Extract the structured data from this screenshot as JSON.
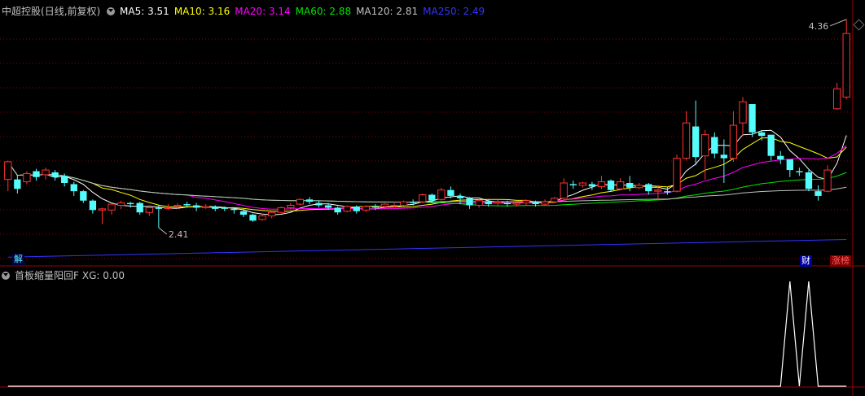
{
  "colors": {
    "bg": "#000000",
    "up": "#ff3232",
    "down": "#54fcfc",
    "ma5": "#ffffff",
    "ma10": "#ffff00",
    "ma20": "#ff00ff",
    "ma60": "#00e600",
    "ma120": "#c0c0c0",
    "ma250": "#3333ff",
    "grid": "#8b0000",
    "axis": "#a00000",
    "xg": "#ffffff"
  },
  "main": {
    "stock_name": "中超控股",
    "period": "(日线,前复权)",
    "ma": [
      {
        "label": "MA5: ",
        "value": "3.51",
        "color": "#ffffff"
      },
      {
        "label": "MA10: ",
        "value": "3.16",
        "color": "#ffff00"
      },
      {
        "label": "MA20: ",
        "value": "3.14",
        "color": "#ff00ff"
      },
      {
        "label": "MA60: ",
        "value": "2.88",
        "color": "#00e600"
      },
      {
        "label": "MA120: ",
        "value": "2.81",
        "color": "#c0c0c0"
      },
      {
        "label": "MA250: ",
        "value": "2.49",
        "color": "#3333ff"
      }
    ],
    "high_label": "4.36",
    "low_label": "2.41",
    "tag_jie": "解",
    "tag_cai": "财",
    "tag_zhangting": "涨榜"
  },
  "sub": {
    "name": "首板缩量阳回F",
    "value_label": "XG: 0.00"
  },
  "chart_data": {
    "type": "candlestick",
    "title": "中超控股 (日线,前复权)",
    "price_range": [
      2.3,
      4.4
    ],
    "candles": [
      [
        3.0,
        3.15,
        3.16,
        2.9
      ],
      [
        3.0,
        2.92,
        3.04,
        2.88
      ],
      [
        2.98,
        3.05,
        3.07,
        2.96
      ],
      [
        3.07,
        3.02,
        3.09,
        2.99
      ],
      [
        3.04,
        3.08,
        3.1,
        3.0
      ],
      [
        3.06,
        3.02,
        3.08,
        2.99
      ],
      [
        3.03,
        2.97,
        3.05,
        2.94
      ],
      [
        2.96,
        2.9,
        2.98,
        2.86
      ],
      [
        2.9,
        2.82,
        2.91,
        2.8
      ],
      [
        2.82,
        2.74,
        2.83,
        2.71
      ],
      [
        2.74,
        2.75,
        2.76,
        2.62
      ],
      [
        2.74,
        2.79,
        2.8,
        2.7
      ],
      [
        2.78,
        2.8,
        2.82,
        2.75
      ],
      [
        2.8,
        2.79,
        2.81,
        2.76
      ],
      [
        2.8,
        2.72,
        2.81,
        2.7
      ],
      [
        2.72,
        2.76,
        2.78,
        2.69
      ],
      [
        2.76,
        2.75,
        2.78,
        2.59
      ],
      [
        2.76,
        2.76,
        2.79,
        2.74
      ],
      [
        2.77,
        2.78,
        2.8,
        2.75
      ],
      [
        2.79,
        2.78,
        2.81,
        2.76
      ],
      [
        2.78,
        2.76,
        2.8,
        2.73
      ],
      [
        2.76,
        2.77,
        2.79,
        2.75
      ],
      [
        2.77,
        2.75,
        2.78,
        2.73
      ],
      [
        2.76,
        2.75,
        2.77,
        2.73
      ],
      [
        2.75,
        2.74,
        2.76,
        2.71
      ],
      [
        2.73,
        2.7,
        2.75,
        2.68
      ],
      [
        2.7,
        2.65,
        2.71,
        2.64
      ],
      [
        2.66,
        2.69,
        2.71,
        2.65
      ],
      [
        2.69,
        2.72,
        2.73,
        2.67
      ],
      [
        2.72,
        2.76,
        2.77,
        2.71
      ],
      [
        2.76,
        2.78,
        2.8,
        2.75
      ],
      [
        2.79,
        2.83,
        2.84,
        2.78
      ],
      [
        2.83,
        2.81,
        2.85,
        2.79
      ],
      [
        2.8,
        2.78,
        2.82,
        2.76
      ],
      [
        2.78,
        2.76,
        2.8,
        2.74
      ],
      [
        2.76,
        2.72,
        2.77,
        2.7
      ],
      [
        2.73,
        2.77,
        2.78,
        2.72
      ],
      [
        2.77,
        2.73,
        2.78,
        2.71
      ],
      [
        2.74,
        2.77,
        2.78,
        2.72
      ],
      [
        2.77,
        2.76,
        2.79,
        2.74
      ],
      [
        2.77,
        2.79,
        2.8,
        2.75
      ],
      [
        2.78,
        2.78,
        2.8,
        2.76
      ],
      [
        2.78,
        2.81,
        2.82,
        2.77
      ],
      [
        2.81,
        2.8,
        2.83,
        2.78
      ],
      [
        2.81,
        2.87,
        2.88,
        2.8
      ],
      [
        2.87,
        2.82,
        2.88,
        2.8
      ],
      [
        2.83,
        2.91,
        2.93,
        2.82
      ],
      [
        2.91,
        2.86,
        2.94,
        2.84
      ],
      [
        2.86,
        2.84,
        2.88,
        2.79
      ],
      [
        2.84,
        2.78,
        2.85,
        2.75
      ],
      [
        2.78,
        2.82,
        2.83,
        2.76
      ],
      [
        2.81,
        2.79,
        2.83,
        2.77
      ],
      [
        2.8,
        2.81,
        2.83,
        2.78
      ],
      [
        2.8,
        2.79,
        2.82,
        2.77
      ],
      [
        2.79,
        2.8,
        2.81,
        2.77
      ],
      [
        2.8,
        2.82,
        2.83,
        2.78
      ],
      [
        2.81,
        2.79,
        2.82,
        2.77
      ],
      [
        2.79,
        2.81,
        2.83,
        2.78
      ],
      [
        2.81,
        2.84,
        2.85,
        2.8
      ],
      [
        2.84,
        2.97,
        3.01,
        2.82
      ],
      [
        2.96,
        2.95,
        2.99,
        2.92
      ],
      [
        2.95,
        2.97,
        2.98,
        2.93
      ],
      [
        2.96,
        2.94,
        2.98,
        2.91
      ],
      [
        2.94,
        2.98,
        3.03,
        2.92
      ],
      [
        2.99,
        2.91,
        3.0,
        2.9
      ],
      [
        2.92,
        2.98,
        3.01,
        2.91
      ],
      [
        2.97,
        2.93,
        3.03,
        2.9
      ],
      [
        2.93,
        2.95,
        2.97,
        2.92
      ],
      [
        2.96,
        2.9,
        2.97,
        2.87
      ],
      [
        2.9,
        2.91,
        2.95,
        2.83
      ],
      [
        2.9,
        2.89,
        2.94,
        2.87
      ],
      [
        2.9,
        3.18,
        3.21,
        2.89
      ],
      [
        3.18,
        3.48,
        3.58,
        3.16
      ],
      [
        3.45,
        3.19,
        3.67,
        3.12
      ],
      [
        3.2,
        3.38,
        3.42,
        3.0
      ],
      [
        3.36,
        3.22,
        3.4,
        3.18
      ],
      [
        3.21,
        3.18,
        3.34,
        2.97
      ],
      [
        3.18,
        3.46,
        3.58,
        3.15
      ],
      [
        3.48,
        3.66,
        3.7,
        3.37
      ],
      [
        3.64,
        3.4,
        3.44,
        3.36
      ],
      [
        3.4,
        3.37,
        3.42,
        3.33
      ],
      [
        3.38,
        3.2,
        3.37,
        3.16
      ],
      [
        3.2,
        3.17,
        3.24,
        3.13
      ],
      [
        3.17,
        3.08,
        3.14,
        3.02
      ],
      [
        3.07,
        3.06,
        3.1,
        3.03
      ],
      [
        3.06,
        2.92,
        3.08,
        2.9
      ],
      [
        2.9,
        2.86,
        2.95,
        2.82
      ],
      [
        2.9,
        3.08,
        3.12,
        2.89
      ],
      [
        3.6,
        3.77,
        3.82,
        3.59
      ],
      [
        3.7,
        4.24,
        4.36,
        3.68
      ]
    ],
    "ma_values": {
      "MA5": 3.51,
      "MA10": 3.16,
      "MA20": 3.14,
      "MA60": 2.88,
      "MA120": 2.81,
      "MA250": 2.49
    },
    "indicator": {
      "name": "首板缩量阳回F",
      "series": "XG",
      "value": 0.0,
      "signals": [
        0,
        0,
        0,
        0,
        0,
        0,
        0,
        0,
        0,
        0,
        0,
        0,
        0,
        0,
        0,
        0,
        0,
        0,
        0,
        0,
        0,
        0,
        0,
        0,
        0,
        0,
        0,
        0,
        0,
        0,
        0,
        0,
        0,
        0,
        0,
        0,
        0,
        0,
        0,
        0,
        0,
        0,
        0,
        0,
        0,
        0,
        0,
        0,
        0,
        0,
        0,
        0,
        0,
        0,
        0,
        0,
        0,
        0,
        0,
        0,
        0,
        0,
        0,
        0,
        0,
        0,
        0,
        0,
        0,
        0,
        0,
        0,
        0,
        0,
        0,
        0,
        0,
        0,
        0,
        0,
        0,
        0,
        0,
        1,
        0,
        1,
        0,
        0,
        0,
        0
      ]
    }
  }
}
